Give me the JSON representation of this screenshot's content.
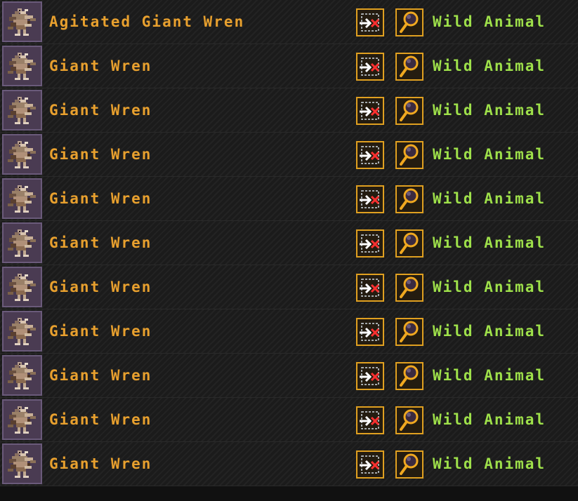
{
  "colors": {
    "name_text": "#e8a02e",
    "status_text": "#9ee04a",
    "button_border": "#e0a020",
    "portrait_bg": "#4a3b52"
  },
  "icons": {
    "portrait": "giant-wren-portrait-icon",
    "remove": "remove-from-list-icon",
    "view": "magnifier-icon"
  },
  "creatures": [
    {
      "name": "Agitated Giant Wren",
      "status": "Wild Animal"
    },
    {
      "name": "Giant Wren",
      "status": "Wild Animal"
    },
    {
      "name": "Giant Wren",
      "status": "Wild Animal"
    },
    {
      "name": "Giant Wren",
      "status": "Wild Animal"
    },
    {
      "name": "Giant Wren",
      "status": "Wild Animal"
    },
    {
      "name": "Giant Wren",
      "status": "Wild Animal"
    },
    {
      "name": "Giant Wren",
      "status": "Wild Animal"
    },
    {
      "name": "Giant Wren",
      "status": "Wild Animal"
    },
    {
      "name": "Giant Wren",
      "status": "Wild Animal"
    },
    {
      "name": "Giant Wren",
      "status": "Wild Animal"
    },
    {
      "name": "Giant Wren",
      "status": "Wild Animal"
    }
  ]
}
